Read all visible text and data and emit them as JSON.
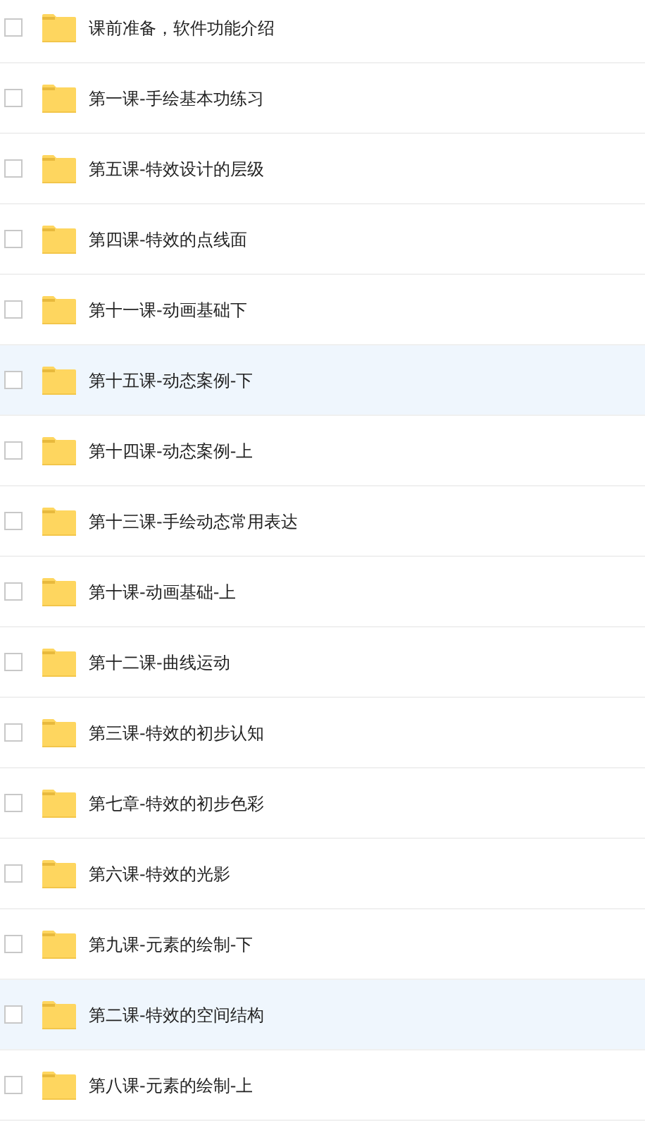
{
  "files": [
    {
      "name": "课前准备，软件功能介绍",
      "checked": false,
      "selected": false
    },
    {
      "name": "第一课-手绘基本功练习",
      "checked": false,
      "selected": false
    },
    {
      "name": "第五课-特效设计的层级",
      "checked": false,
      "selected": false
    },
    {
      "name": "第四课-特效的点线面",
      "checked": false,
      "selected": false
    },
    {
      "name": "第十一课-动画基础下",
      "checked": false,
      "selected": false
    },
    {
      "name": "第十五课-动态案例-下",
      "checked": false,
      "selected": true
    },
    {
      "name": "第十四课-动态案例-上",
      "checked": false,
      "selected": false
    },
    {
      "name": "第十三课-手绘动态常用表达",
      "checked": false,
      "selected": false
    },
    {
      "name": "第十课-动画基础-上",
      "checked": false,
      "selected": false
    },
    {
      "name": "第十二课-曲线运动",
      "checked": false,
      "selected": false
    },
    {
      "name": "第三课-特效的初步认知",
      "checked": false,
      "selected": false
    },
    {
      "name": "第七章-特效的初步色彩",
      "checked": false,
      "selected": false
    },
    {
      "name": "第六课-特效的光影",
      "checked": false,
      "selected": false
    },
    {
      "name": "第九课-元素的绘制-下",
      "checked": false,
      "selected": false
    },
    {
      "name": "第二课-特效的空间结构",
      "checked": false,
      "selected": true
    },
    {
      "name": "第八课-元素的绘制-上",
      "checked": false,
      "selected": false
    }
  ]
}
